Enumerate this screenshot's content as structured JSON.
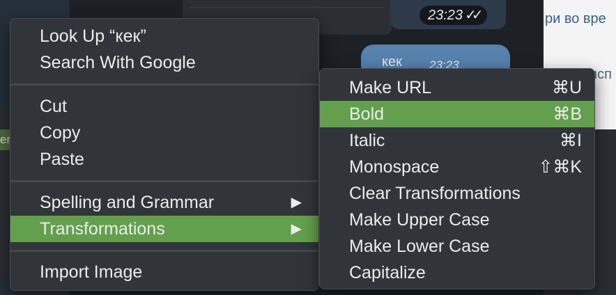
{
  "background": {
    "time_label": "23:23",
    "time_checks": "✓✓",
    "bubble_text": "кек",
    "bubble_time": "23:23",
    "snippet_top": "ри во вре",
    "snippet_mid": "исп",
    "left_snippet": "er"
  },
  "context_menu": {
    "items": [
      {
        "label": "Look Up “кек”"
      },
      {
        "label": "Search With Google"
      },
      {
        "label": "Cut"
      },
      {
        "label": "Copy"
      },
      {
        "label": "Paste"
      },
      {
        "label": "Spelling and Grammar",
        "submenu_arrow": "▶"
      },
      {
        "label": "Transformations",
        "submenu_arrow": "▶",
        "highlighted": true
      },
      {
        "label": "Import Image"
      }
    ]
  },
  "transformations_menu": {
    "items": [
      {
        "label": "Make URL",
        "shortcut": "⌘U"
      },
      {
        "label": "Bold",
        "shortcut": "⌘B",
        "highlighted": true
      },
      {
        "label": "Italic",
        "shortcut": "⌘I"
      },
      {
        "label": "Monospace",
        "shortcut": "⇧⌘K"
      },
      {
        "label": "Clear Transformations"
      },
      {
        "label": "Make Upper Case"
      },
      {
        "label": "Make Lower Case"
      },
      {
        "label": "Capitalize"
      }
    ]
  },
  "colors": {
    "highlight": "#63a04d",
    "menu_bg": "#313439",
    "bubble": "#5682ad"
  }
}
